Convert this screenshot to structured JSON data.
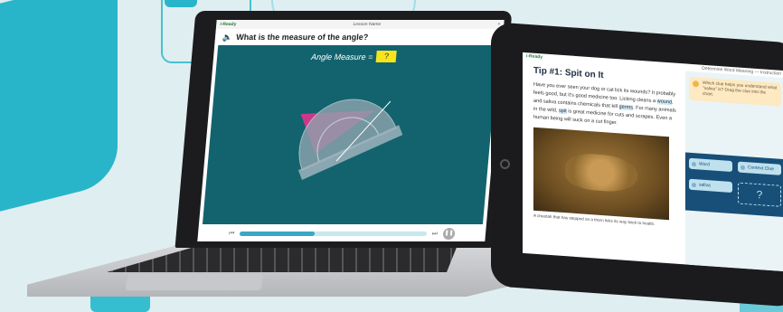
{
  "laptop": {
    "window_title": "Lesson Name",
    "question": "What is the measure of the angle?",
    "measure_label": "Angle Measure =",
    "measure_value": "?",
    "progress": 0.4
  },
  "tablet": {
    "header_title": "Determine Word Meaning — Instruction",
    "tip_title": "Tip #1: Spit on It",
    "paragraph_1": "Have you ever seen your dog or cat lick its wounds? It probably feels good, but it's good medicine too. Licking cleans a ",
    "word_wound": "wound",
    "paragraph_2": ", and saliva contains chemicals that kill ",
    "word_germs": "germs",
    "paragraph_3": ". For many animals in the wild, ",
    "word_spit": "spit",
    "paragraph_4": " is great medicine for cuts and scrapes. Even a human being will suck on a cut finger.",
    "caption": "A cheetah that has stepped on a thorn licks its way back to health.",
    "hint": "Which clue helps you understand what \"saliva\" is? Drag the clue into the chart.",
    "chip_word": "Word",
    "chip_context": "Context Clue",
    "chip_saliva": "saliva",
    "slot_placeholder": "?",
    "logo": "i-Ready"
  },
  "colors": {
    "accent": "#29b5c9",
    "stage": "#12636e",
    "highlight": "#f7e51a"
  }
}
